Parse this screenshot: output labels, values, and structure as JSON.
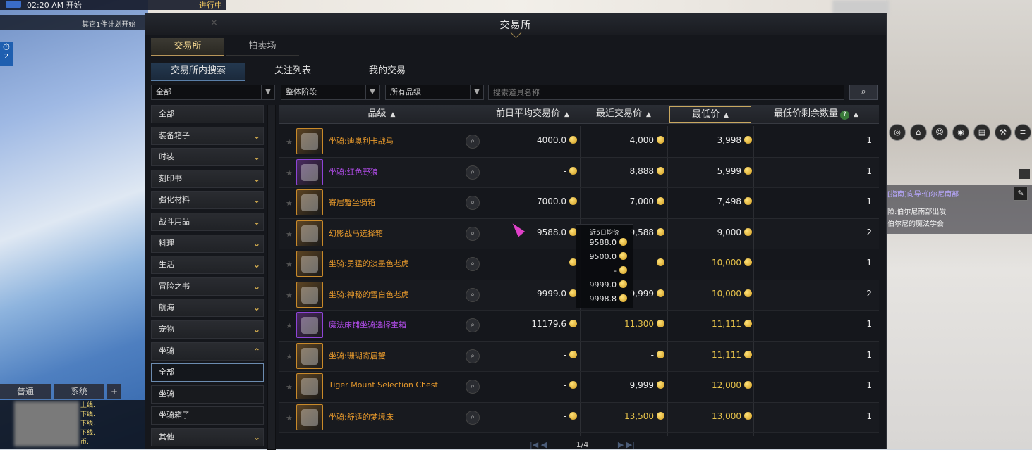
{
  "hud": {
    "quest_time": "02:20 AM 开始",
    "quest_status": "进行中",
    "plan_text": "其它1件计划开始",
    "timer_count": "2",
    "chat_tabs": [
      "普通",
      "系统",
      "+"
    ],
    "chat_lines": [
      "上线.",
      "下线.",
      "下线.",
      "下线.",
      "币."
    ],
    "quest_title": "[指南]向导:伯尔尼南部",
    "quest_line1": "险:伯尔尼南部出发",
    "quest_line2": "伯尔尼的魔法学会",
    "close_label": "X"
  },
  "window": {
    "title": "交易所",
    "tabs": [
      "交易所",
      "拍卖场"
    ],
    "subtabs": [
      "交易所内搜索",
      "关注列表",
      "我的交易"
    ],
    "filters": {
      "category": "全部",
      "tier": "整体阶段",
      "grade": "所有品级",
      "search_placeholder": "搜索道具名称"
    }
  },
  "categories": [
    {
      "label": "全部",
      "expand": ""
    },
    {
      "label": "装备箱子",
      "expand": "down"
    },
    {
      "label": "时装",
      "expand": "down"
    },
    {
      "label": "刻印书",
      "expand": "down"
    },
    {
      "label": "强化材料",
      "expand": "down"
    },
    {
      "label": "战斗用品",
      "expand": "down"
    },
    {
      "label": "料理",
      "expand": "down"
    },
    {
      "label": "生活",
      "expand": "down"
    },
    {
      "label": "冒险之书",
      "expand": "down"
    },
    {
      "label": "航海",
      "expand": "down"
    },
    {
      "label": "宠物",
      "expand": "down"
    },
    {
      "label": "坐骑",
      "expand": "up"
    },
    {
      "label": "全部",
      "expand": "",
      "sub": true,
      "selected": true
    },
    {
      "label": "坐骑",
      "expand": "",
      "sub": true
    },
    {
      "label": "坐骑箱子",
      "expand": "",
      "sub": true
    },
    {
      "label": "其他",
      "expand": "down"
    }
  ],
  "table": {
    "headers": [
      "品级",
      "前日平均交易价",
      "最近交易价",
      "最低价",
      "最低价剩余数量"
    ],
    "rows": [
      {
        "name": "坐骑:迪奥利卡战马",
        "grade": "legendary",
        "avg": "4000.0",
        "recent": "4,000",
        "lowest": "3,998",
        "lowest_gold": false,
        "qty": "1"
      },
      {
        "name": "坐骑:红色野狼",
        "grade": "epic",
        "avg": "-",
        "recent": "8,888",
        "lowest": "5,999",
        "lowest_gold": false,
        "qty": "1"
      },
      {
        "name": "寄居蟹坐骑箱",
        "grade": "legendary",
        "avg": "7000.0",
        "recent": "7,000",
        "lowest": "7,498",
        "lowest_gold": false,
        "qty": "1"
      },
      {
        "name": "幻影战马选择箱",
        "grade": "legendary",
        "avg": "9588.0",
        "recent": "9,588",
        "lowest": "9,000",
        "lowest_gold": false,
        "qty": "2"
      },
      {
        "name": "坐骑:勇猛的淡墨色老虎",
        "grade": "legendary",
        "avg": "-",
        "recent": "-",
        "lowest": "10,000",
        "lowest_gold": true,
        "qty": "1"
      },
      {
        "name": "坐骑:神秘的雪白色老虎",
        "grade": "legendary",
        "avg": "9999.0",
        "recent": "9,999",
        "lowest": "10,000",
        "lowest_gold": true,
        "qty": "2"
      },
      {
        "name": "魔法床铺坐骑选择宝箱",
        "grade": "epic",
        "avg": "11179.6",
        "recent": "11,300",
        "recent_gold": true,
        "lowest": "11,111",
        "lowest_gold": true,
        "qty": "1"
      },
      {
        "name": "坐骑:珊瑚寄居蟹",
        "grade": "legendary",
        "avg": "-",
        "recent": "-",
        "lowest": "11,111",
        "lowest_gold": true,
        "qty": "1"
      },
      {
        "name": "Tiger Mount Selection Chest",
        "grade": "legendary",
        "avg": "-",
        "recent": "9,999",
        "lowest": "12,000",
        "lowest_gold": true,
        "qty": "1"
      },
      {
        "name": "坐骑:舒适的梦境床",
        "grade": "legendary",
        "avg": "-",
        "recent": "13,500",
        "recent_gold": true,
        "lowest": "13,000",
        "lowest_gold": true,
        "qty": "1"
      }
    ]
  },
  "tooltip": {
    "title": "近5日均价",
    "values": [
      "9588.0",
      "9500.0",
      "-",
      "9999.0",
      "9998.8"
    ]
  },
  "pager": {
    "text": "1/4"
  },
  "colors": {
    "legendary": "#e89a2c",
    "epic": "#b04ce8",
    "gold_text": "#e6c24a",
    "accent": "#c9a860"
  }
}
